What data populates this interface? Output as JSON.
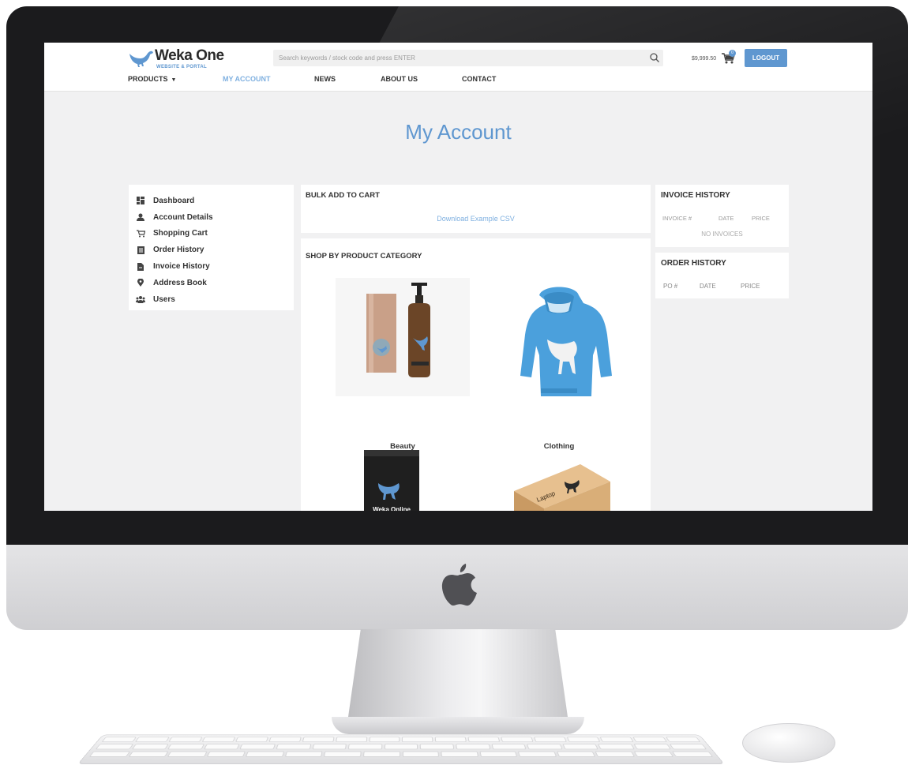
{
  "brand": {
    "name": "Weka One",
    "tagline": "WEBSITE & PORTAL",
    "accent": "#5f97d0"
  },
  "search": {
    "placeholder": "Search keywords / stock code and press ENTER",
    "icon": "search-icon"
  },
  "cart": {
    "total": "$9,999.50",
    "count": "0",
    "icon": "cart-icon"
  },
  "header": {
    "logout_label": "LOGOUT"
  },
  "nav": {
    "items": [
      {
        "label": "PRODUCTS",
        "has_dropdown": true
      },
      {
        "label": "MY ACCOUNT",
        "active": true
      },
      {
        "label": "NEWS"
      },
      {
        "label": "ABOUT US"
      },
      {
        "label": "CONTACT"
      }
    ]
  },
  "page": {
    "title": "My Account"
  },
  "sidebar": {
    "items": [
      {
        "label": "Dashboard",
        "icon": "dashboard-icon"
      },
      {
        "label": "Account Details",
        "icon": "user-icon"
      },
      {
        "label": "Shopping Cart",
        "icon": "cart-icon"
      },
      {
        "label": "Order History",
        "icon": "list-icon"
      },
      {
        "label": "Invoice History",
        "icon": "invoice-icon"
      },
      {
        "label": "Address Book",
        "icon": "map-pin-icon"
      },
      {
        "label": "Users",
        "icon": "users-icon"
      }
    ]
  },
  "bulk": {
    "title": "BULK ADD TO CART",
    "link": "Download Example CSV"
  },
  "shop": {
    "title": "SHOP BY PRODUCT CATEGORY",
    "categories": [
      {
        "name": "Beauty"
      },
      {
        "name": "Clothing"
      },
      {
        "name": ""
      },
      {
        "name": ""
      }
    ]
  },
  "invoice_history": {
    "title": "INVOICE HISTORY",
    "columns": [
      "INVOICE #",
      "DATE",
      "PRICE"
    ],
    "empty": "NO INVOICES"
  },
  "order_history": {
    "title": "ORDER HISTORY",
    "columns": [
      "PO #",
      "DATE",
      "PRICE"
    ]
  }
}
